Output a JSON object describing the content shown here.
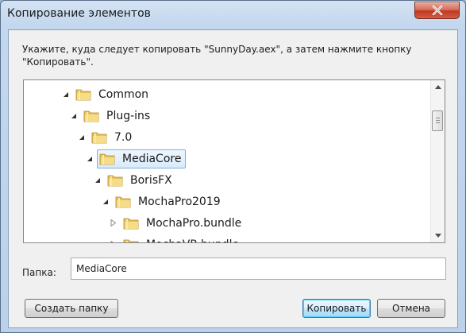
{
  "window": {
    "title": "Копирование элементов"
  },
  "dialog": {
    "instruction": "Укажите, куда следует копировать \"SunnyDay.aex\", а затем нажмите кнопку \"Копировать\".",
    "tree": {
      "items": [
        {
          "label": "Common",
          "expanded": true,
          "selected": false
        },
        {
          "label": "Plug-ins",
          "expanded": true,
          "selected": false
        },
        {
          "label": "7.0",
          "expanded": true,
          "selected": false
        },
        {
          "label": "MediaCore",
          "expanded": true,
          "selected": true
        },
        {
          "label": "BorisFX",
          "expanded": true,
          "selected": false
        },
        {
          "label": "MochaPro2019",
          "expanded": true,
          "selected": false
        },
        {
          "label": "MochaPro.bundle",
          "expanded": false,
          "selected": false
        },
        {
          "label": "MochaVR.bundle",
          "expanded": false,
          "selected": false
        }
      ]
    },
    "folder_label": "Папка:",
    "folder_value": "MediaCore",
    "buttons": {
      "create_folder": "Создать папку",
      "copy": "Копировать",
      "cancel": "Отмена"
    }
  },
  "colors": {
    "selection_border": "#84acdd",
    "default_button_border": "#3c7fb1",
    "close_button": "#c0391f"
  }
}
